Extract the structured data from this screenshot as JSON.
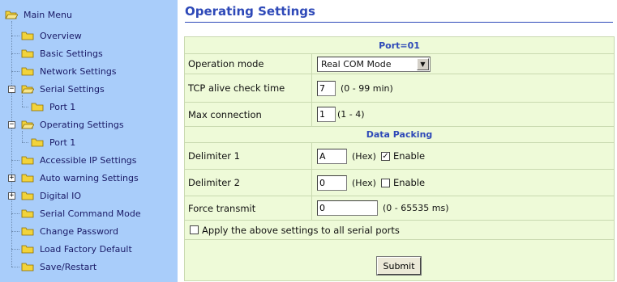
{
  "menu": {
    "root_label": "Main Menu",
    "items": [
      {
        "label": "Overview"
      },
      {
        "label": "Basic Settings"
      },
      {
        "label": "Network Settings"
      },
      {
        "label": "Serial Settings"
      },
      {
        "label": "Port 1"
      },
      {
        "label": "Operating Settings"
      },
      {
        "label": "Port 1"
      },
      {
        "label": "Accessible IP Settings"
      },
      {
        "label": "Auto warning Settings"
      },
      {
        "label": "Digital IO"
      },
      {
        "label": "Serial Command Mode"
      },
      {
        "label": "Change Password"
      },
      {
        "label": "Load Factory Default"
      },
      {
        "label": "Save/Restart"
      }
    ]
  },
  "page": {
    "title": "Operating Settings"
  },
  "port_section": {
    "header": "Port=01",
    "operation_mode": {
      "label": "Operation mode",
      "value": "Real COM Mode"
    },
    "tcp_alive": {
      "label": "TCP alive check time",
      "value": "7",
      "hint": "(0 - 99 min)"
    },
    "max_connection": {
      "label": "Max connection",
      "value": "1",
      "hint": "(1 - 4)"
    }
  },
  "data_packing": {
    "header": "Data Packing",
    "delimiter1": {
      "label": "Delimiter 1",
      "value": "A",
      "unit": "(Hex)",
      "enable_label": "Enable",
      "enabled": true
    },
    "delimiter2": {
      "label": "Delimiter 2",
      "value": "0",
      "unit": "(Hex)",
      "enable_label": "Enable",
      "enabled": false
    },
    "force_transmit": {
      "label": "Force transmit",
      "value": "0",
      "hint": "(0 - 65535 ms)"
    },
    "apply_all": {
      "label": "Apply the above settings to all serial ports",
      "checked": false
    }
  },
  "actions": {
    "submit_label": "Submit"
  },
  "colors": {
    "sidebar_bg": "#a9cdfa",
    "panel_bg": "#eefad8",
    "title_blue": "#2e49b8",
    "folder_yellow": "#f2d33b"
  }
}
